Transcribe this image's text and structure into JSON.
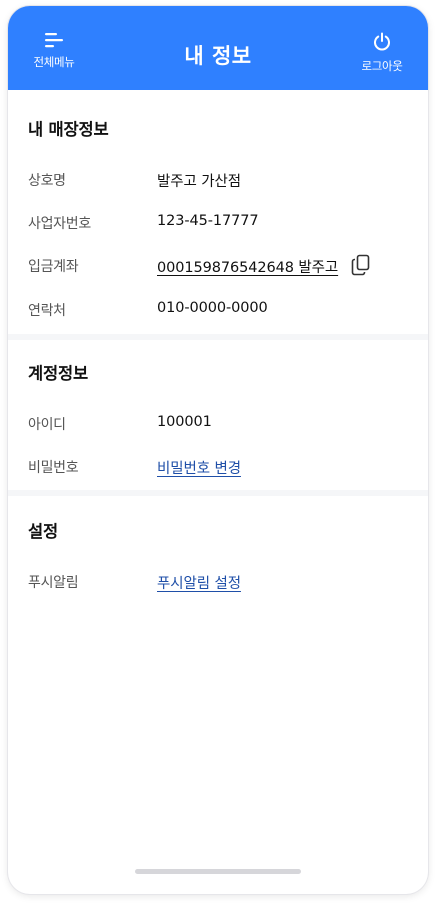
{
  "header": {
    "title": "내 정보",
    "menu_label": "전체메뉴",
    "logout_label": "로그아웃"
  },
  "store_info": {
    "title": "내 매장정보",
    "rows": [
      {
        "key": "상호명",
        "value": "발주고 가산점"
      },
      {
        "key": "사업자번호",
        "value": "123-45-17777"
      },
      {
        "key": "입금계좌",
        "value": "000159876542648 발주고"
      },
      {
        "key": "연락처",
        "value": "010-0000-0000"
      }
    ]
  },
  "account_info": {
    "title": "계정정보",
    "id_key": "아이디",
    "id_value": "100001",
    "password_key": "비밀번호",
    "password_link": "비밀번호 변경"
  },
  "settings": {
    "title": "설정",
    "push_key": "푸시알림",
    "push_link": "푸시알림 설정"
  },
  "colors": {
    "header_bg": "#2f80ff",
    "link": "#1f4fa8"
  },
  "icons": {
    "menu": "menu-lines-icon",
    "logout": "power-icon",
    "copy": "copy-icon"
  }
}
